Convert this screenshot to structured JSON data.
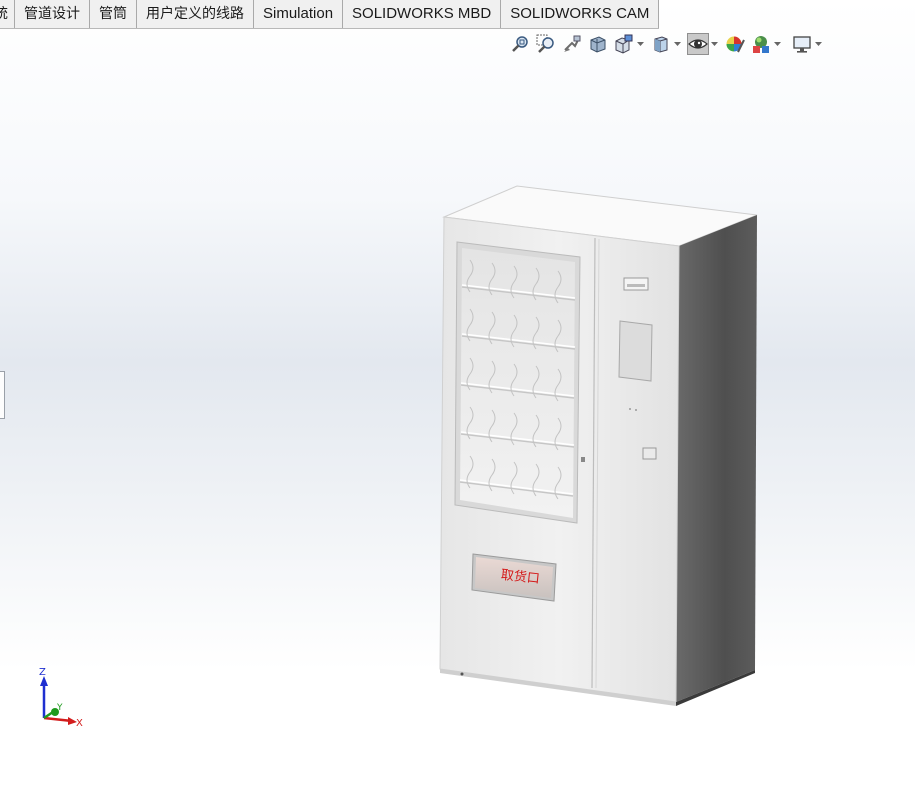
{
  "tabs": [
    {
      "label": "统"
    },
    {
      "label": "管道设计"
    },
    {
      "label": "管筒"
    },
    {
      "label": "用户定义的线路"
    },
    {
      "label": "Simulation"
    },
    {
      "label": "SOLIDWORKS MBD"
    },
    {
      "label": "SOLIDWORKS CAM"
    }
  ],
  "toolbar": {
    "icons": [
      "zoom-to-fit-icon",
      "zoom-to-area-icon",
      "previous-view-icon",
      "section-view-icon",
      "view-orientation-icon",
      "display-style-icon",
      "hide-show-items-icon",
      "edit-appearance-icon",
      "apply-scene-icon",
      "view-settings-icon"
    ]
  },
  "model": {
    "dispense_label": "取货口"
  },
  "triad": {
    "x": "X",
    "y": "Y",
    "z": "Z"
  },
  "colors": {
    "tab_bg": "#f0f0f0",
    "machine_body": "#ededed",
    "machine_side": "#5a5a5a",
    "dispense_text": "#d41818",
    "axis_x": "#d21c1c",
    "axis_y": "#1e9a1e",
    "axis_z": "#1f2fd0"
  }
}
